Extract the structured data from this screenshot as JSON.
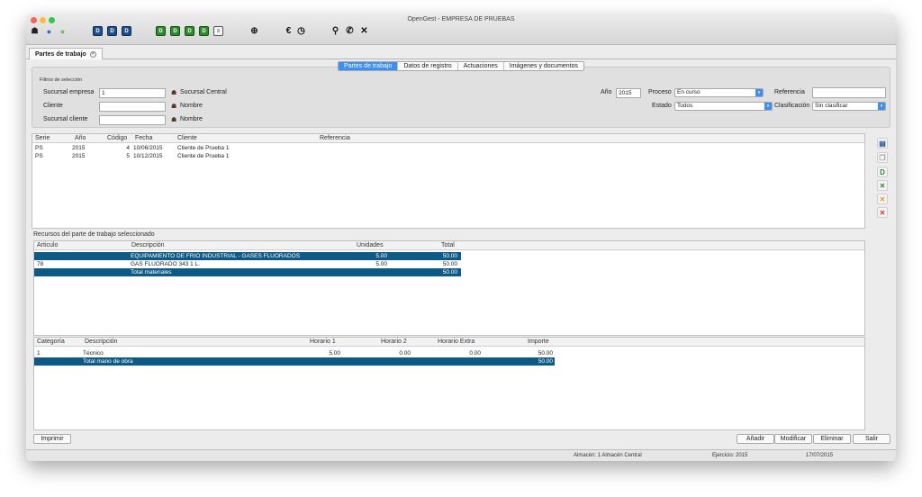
{
  "window": {
    "title": "OpenGest - EMPRESA DE PRUEBAS"
  },
  "toolbar": {
    "icons": [
      "team-icon",
      "user-blue-icon",
      "user-green-icon",
      "doc-blue-1-icon",
      "doc-blue-2-icon",
      "doc-blue-3-icon",
      "doc-green-1-icon",
      "doc-green-2-icon",
      "doc-green-3-icon",
      "doc-green-4-icon",
      "doc-gray-icon",
      "globe-icon",
      "euro-icon",
      "clock-icon",
      "search-icon",
      "phone-icon",
      "tools-icon"
    ],
    "doc_letter": "D"
  },
  "main_tab": {
    "label": "Partes de trabajo"
  },
  "subtabs": [
    "Partes de trabajo",
    "Datos de registro",
    "Actuaciones",
    "Imágenes y documentos"
  ],
  "filters": {
    "title": "Filtros de selección",
    "sucursal_empresa_label": "Sucursal empresa",
    "sucursal_empresa_value": "1",
    "sucursal_empresa_name": "Sucursal Central",
    "cliente_label": "Cliente",
    "cliente_value": "",
    "cliente_name": "Nombre",
    "sucursal_cliente_label": "Sucursal cliente",
    "sucursal_cliente_value": "",
    "sucursal_cliente_name": "Nombre",
    "anio_label": "Año",
    "anio_value": "2015",
    "proceso_label": "Proceso",
    "proceso_value": "En curso",
    "estado_label": "Estado",
    "estado_value": "Todos",
    "referencia_label": "Referencia",
    "referencia_value": "",
    "clasificacion_label": "Clasificación",
    "clasificacion_value": "Sin clasificar"
  },
  "partes": {
    "headers": [
      "Serie",
      "Año",
      "Código",
      "Fecha",
      "Cliente",
      "Referencia"
    ],
    "rows": [
      [
        "PS",
        "2015",
        "4",
        "10/06/2015",
        "Cliente de Prueba 1",
        ""
      ],
      [
        "PS",
        "2015",
        "5",
        "10/12/2015",
        "Cliente de Prueba 1",
        ""
      ]
    ]
  },
  "recursos": {
    "title": "Recursos del parte de trabajo seleccionado",
    "headers": [
      "Articulo",
      "Descripción",
      "Unidades",
      "Total"
    ],
    "rows": [
      [
        "",
        "EQUIPAMIENTO DE FRIO INDUSTRIAL - GASES FLUORADOS",
        "5.00",
        "50.00"
      ],
      [
        "78",
        "GAS FLUORADO 343 1 L.",
        "5.00",
        "50.00"
      ],
      [
        "",
        "Total materiales",
        "",
        "50.00"
      ]
    ]
  },
  "mano_obra": {
    "headers": [
      "Categoría",
      "Descripción",
      "Horario 1",
      "Horario 2",
      "Horario Extra",
      "Importe"
    ],
    "rows": [
      [
        "1",
        "Técnico",
        "5.00",
        "0.00",
        "0.00",
        "50.00"
      ],
      [
        "",
        "Total mano de obra",
        "",
        "",
        "",
        "50.00"
      ]
    ]
  },
  "side_icons": [
    "print-icon",
    "copy-icon",
    "doc-green-icon",
    "tools-green-icon",
    "tools-orange-icon",
    "tools-red-icon"
  ],
  "buttons": {
    "imprimir": "Imprimir",
    "anadir": "Añadir",
    "modificar": "Modificar",
    "eliminar": "Eliminar",
    "salir": "Salir"
  },
  "status": {
    "almacen": "Almacén: 1 Almacén Central",
    "ejercicio": "Ejercicio: 2015",
    "fecha": "17/07/2015"
  }
}
